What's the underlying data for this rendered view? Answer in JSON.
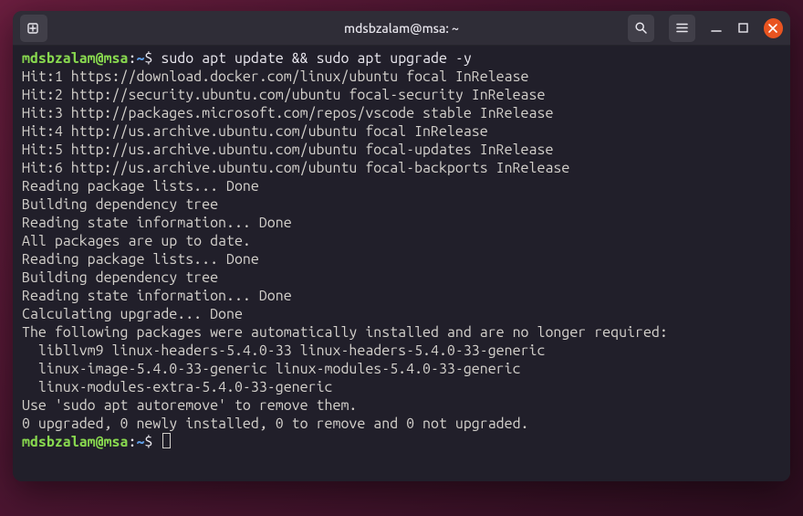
{
  "window": {
    "title": "mdsbzalam@msa: ~"
  },
  "prompt": {
    "user_host": "mdsbzalam@msa",
    "path": "~",
    "sep": ":",
    "symbol": "$"
  },
  "commands": {
    "first": "sudo apt update && sudo apt upgrade -y",
    "second": ""
  },
  "output": [
    "Hit:1 https://download.docker.com/linux/ubuntu focal InRelease",
    "Hit:2 http://security.ubuntu.com/ubuntu focal-security InRelease",
    "Hit:3 http://packages.microsoft.com/repos/vscode stable InRelease",
    "Hit:4 http://us.archive.ubuntu.com/ubuntu focal InRelease",
    "Hit:5 http://us.archive.ubuntu.com/ubuntu focal-updates InRelease",
    "Hit:6 http://us.archive.ubuntu.com/ubuntu focal-backports InRelease",
    "Reading package lists... Done",
    "Building dependency tree",
    "Reading state information... Done",
    "All packages are up to date.",
    "Reading package lists... Done",
    "Building dependency tree",
    "Reading state information... Done",
    "Calculating upgrade... Done",
    "The following packages were automatically installed and are no longer required:",
    "  libllvm9 linux-headers-5.4.0-33 linux-headers-5.4.0-33-generic",
    "  linux-image-5.4.0-33-generic linux-modules-5.4.0-33-generic",
    "  linux-modules-extra-5.4.0-33-generic",
    "Use 'sudo apt autoremove' to remove them.",
    "0 upgraded, 0 newly installed, 0 to remove and 0 not upgraded."
  ]
}
